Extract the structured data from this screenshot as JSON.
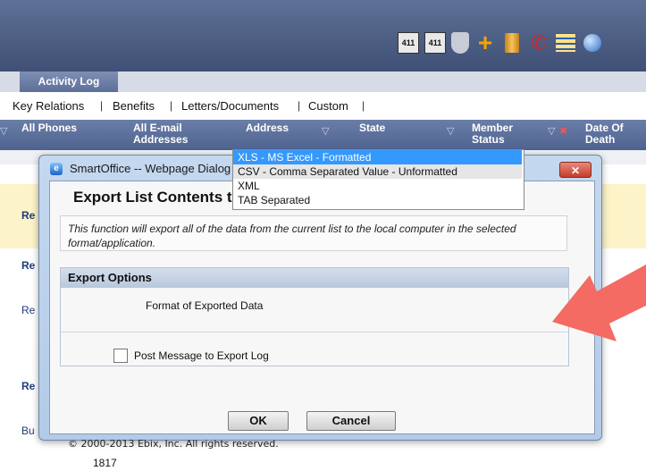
{
  "tabs": {
    "active": "Activity Log"
  },
  "links": [
    "Key Relations",
    "Benefits",
    "Letters/Documents",
    "Custom"
  ],
  "columns": [
    "All Phones",
    "All E-mail Addresses",
    "Address",
    "State",
    "Member Status",
    "Date Of Death"
  ],
  "background_rows": {
    "row1": "Re",
    "row2": "Re",
    "row3": "Re",
    "row4": "Re",
    "row5": "Bu",
    "number": "1817"
  },
  "toolbar": {
    "icon1": "411",
    "icon2": "411"
  },
  "dialog": {
    "window_title": "SmartOffice -- Webpage Dialog",
    "close_glyph": "✕",
    "heading": "Export List Contents to Local Computer",
    "description": "This function will export all of the data from the current list to the local computer in the selected format/application.",
    "section_title": "Export Options",
    "format_label": "Format of Exported Data",
    "format_options": [
      "XLS - MS Excel - Formatted",
      "CSV - Comma Separated Value - Unformatted",
      "XML",
      "TAB Separated"
    ],
    "selected_format": "XLS - MS Excel - Formatted",
    "post_message_label": "Post Message to Export Log",
    "ok_label": "OK",
    "cancel_label": "Cancel",
    "copyright": "© 2000-2013 Ebix, Inc. All rights reserved."
  },
  "colors": {
    "accent_arrow": "#f36b63",
    "selection": "#3399ff",
    "header": "#5a6d98"
  },
  "icons": [
    "directory-411-icon",
    "directory-411-icon",
    "shield-icon",
    "add-icon",
    "trash-icon",
    "phone-icon",
    "list-icon",
    "globe-icon"
  ]
}
